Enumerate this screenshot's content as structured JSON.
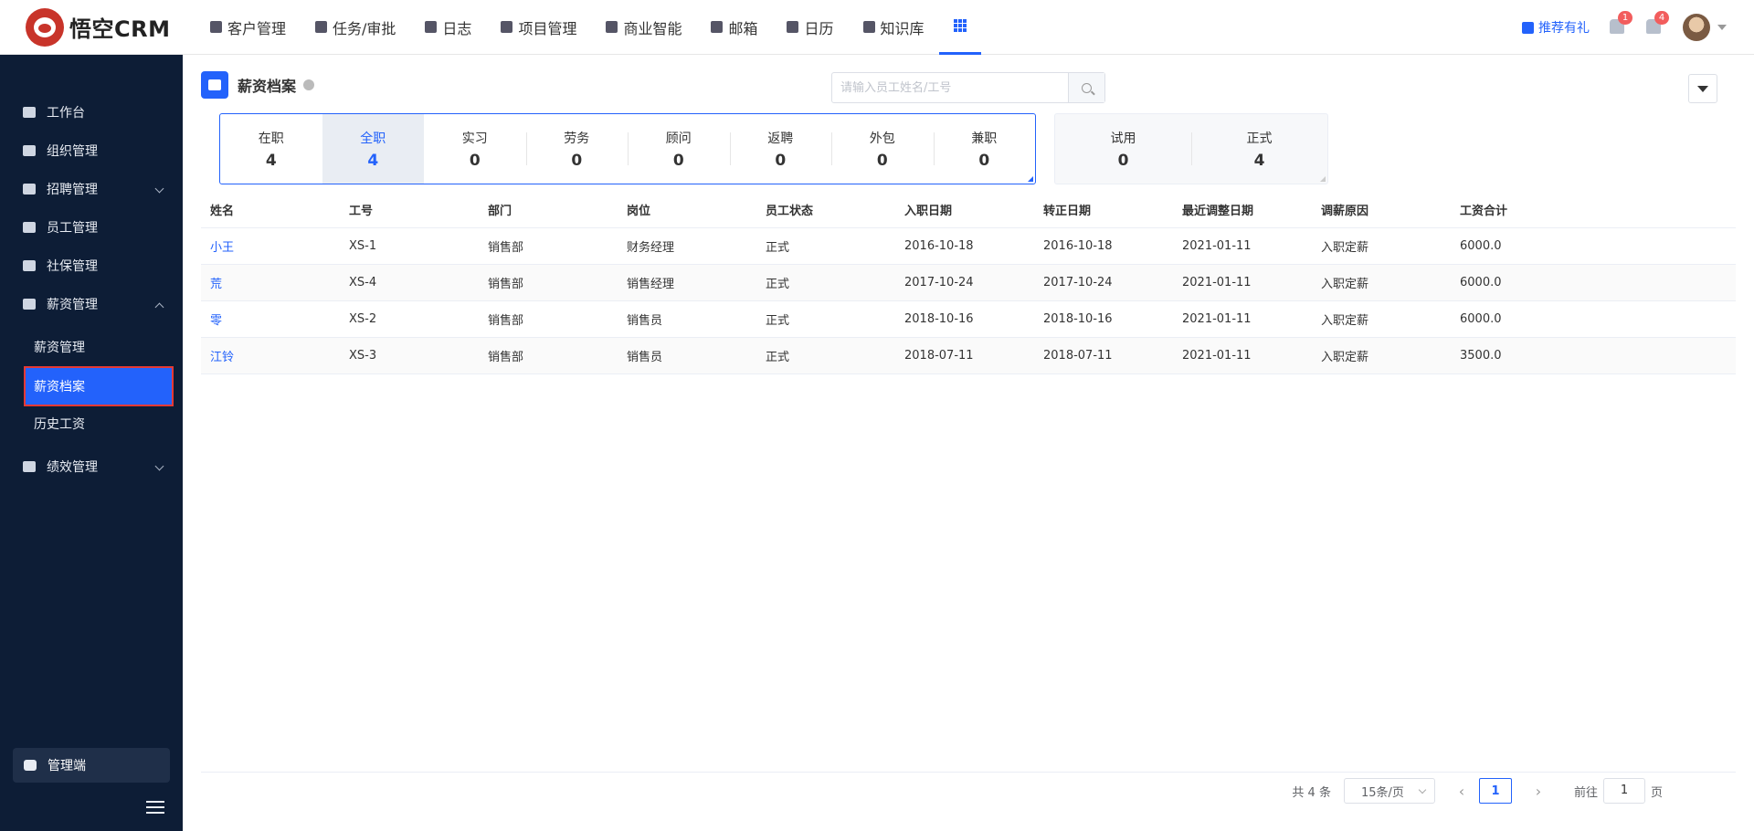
{
  "app": {
    "brand": "悟空CRM"
  },
  "nav": {
    "items": [
      {
        "label": "客户管理",
        "icon": "building-icon"
      },
      {
        "label": "任务/审批",
        "icon": "briefcase-icon"
      },
      {
        "label": "日志",
        "icon": "log-icon"
      },
      {
        "label": "项目管理",
        "icon": "project-icon"
      },
      {
        "label": "商业智能",
        "icon": "bi-icon"
      },
      {
        "label": "邮箱",
        "icon": "mail-icon"
      },
      {
        "label": "日历",
        "icon": "calendar-icon"
      },
      {
        "label": "知识库",
        "icon": "book-icon"
      }
    ],
    "apps_icon": "grid-icon"
  },
  "header_right": {
    "promo": "推荐有礼",
    "announce_badge": "1",
    "notify_badge": "4"
  },
  "sidebar": {
    "items": [
      {
        "label": "工作台"
      },
      {
        "label": "组织管理"
      },
      {
        "label": "招聘管理"
      },
      {
        "label": "员工管理"
      },
      {
        "label": "社保管理"
      },
      {
        "label": "薪资管理"
      },
      {
        "label": "绩效管理"
      }
    ],
    "sub_items": [
      {
        "label": "薪资管理"
      },
      {
        "label": "薪资档案"
      },
      {
        "label": "历史工资"
      }
    ],
    "admin": "管理端"
  },
  "page": {
    "title": "薪资档案",
    "search_placeholder": "请输入员工姓名/工号"
  },
  "stats": [
    {
      "label": "在职",
      "value": "4"
    },
    {
      "label": "全职",
      "value": "4"
    },
    {
      "label": "实习",
      "value": "0"
    },
    {
      "label": "劳务",
      "value": "0"
    },
    {
      "label": "顾问",
      "value": "0"
    },
    {
      "label": "返聘",
      "value": "0"
    },
    {
      "label": "外包",
      "value": "0"
    },
    {
      "label": "兼职",
      "value": "0"
    }
  ],
  "stats2": [
    {
      "label": "试用",
      "value": "0"
    },
    {
      "label": "正式",
      "value": "4"
    }
  ],
  "table": {
    "headers": [
      "姓名",
      "工号",
      "部门",
      "岗位",
      "员工状态",
      "入职日期",
      "转正日期",
      "最近调整日期",
      "调薪原因",
      "工资合计"
    ],
    "rows": [
      [
        "小王",
        "XS-1",
        "销售部",
        "财务经理",
        "正式",
        "2016-10-18",
        "2016-10-18",
        "2021-01-11",
        "入职定薪",
        "6000.0"
      ],
      [
        "荒",
        "XS-4",
        "销售部",
        "销售经理",
        "正式",
        "2017-10-24",
        "2017-10-24",
        "2021-01-11",
        "入职定薪",
        "6000.0"
      ],
      [
        "零",
        "XS-2",
        "销售部",
        "销售员",
        "正式",
        "2018-10-16",
        "2018-10-16",
        "2021-01-11",
        "入职定薪",
        "6000.0"
      ],
      [
        "江铃",
        "XS-3",
        "销售部",
        "销售员",
        "正式",
        "2018-07-11",
        "2018-07-11",
        "2021-01-11",
        "入职定薪",
        "3500.0"
      ]
    ]
  },
  "pagination": {
    "total": "共 4 条",
    "page_size": "15条/页",
    "prev": "‹",
    "current": "1",
    "next": "›",
    "goto_label": "前往",
    "goto_value": "1",
    "goto_suffix": "页"
  },
  "colors": {
    "accent": "#2362fb",
    "sidebar": "#0d1d36"
  }
}
